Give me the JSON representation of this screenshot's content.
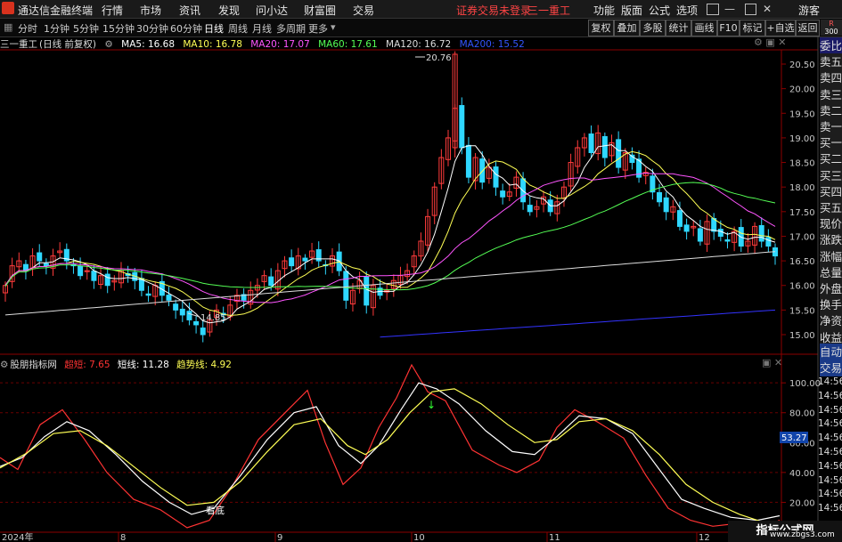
{
  "app_title": "通达信金融终端",
  "menu": [
    "行情",
    "市场",
    "资讯",
    "发现",
    "问小达",
    "财富圈",
    "交易"
  ],
  "status_notice": "证券交易未登录",
  "stock_name_top": "三一重工",
  "right_menu": [
    "功能",
    "版面",
    "公式",
    "选项"
  ],
  "guest": "游客",
  "periods": [
    "分时",
    "1分钟",
    "5分钟",
    "15分钟",
    "30分钟",
    "60分钟",
    "日线",
    "周线",
    "月线",
    "多周期",
    "更多"
  ],
  "active_period": "日线",
  "toolbar_buttons": [
    "复权",
    "叠加",
    "多股",
    "统计",
    "画线",
    "F10",
    "标记",
    "+自选",
    "返回"
  ],
  "colors": {
    "bg": "#000000",
    "up": "#ff3b3b",
    "down": "#2fd7ff",
    "ma5": "#ffffff",
    "ma10": "#ffff55",
    "ma20": "#ff55ff",
    "ma60": "#55ff55",
    "ma120": "#dddddd",
    "ma200": "#3333ff",
    "grid": "#8b0000",
    "price_label": "#ff5555"
  },
  "main_legend": {
    "stock": "三一重工",
    "mode": "(日线 前复权)",
    "ma": [
      {
        "label": "MA5: 16.68",
        "color": "#ffffff"
      },
      {
        "label": "MA10: 16.78",
        "color": "#ffff55"
      },
      {
        "label": "MA20: 17.07",
        "color": "#ff55ff"
      },
      {
        "label": "MA60: 17.61",
        "color": "#55ff55"
      },
      {
        "label": "MA120: 16.72",
        "color": "#dddddd"
      },
      {
        "label": "MA200: 15.52",
        "color": "#3355ff"
      }
    ]
  },
  "price_axis": [
    "20.50",
    "20.00",
    "19.50",
    "19.00",
    "18.50",
    "18.00",
    "17.50",
    "17.00",
    "16.50",
    "16.00",
    "15.50",
    "15.00"
  ],
  "high_marker": "20.76",
  "low_marker": "14.85",
  "right_panel_labels": [
    "委比",
    "卖五",
    "卖四",
    "卖三",
    "卖二",
    "卖一",
    "买一",
    "买二",
    "买三",
    "买四",
    "买五",
    "现价",
    "涨跌",
    "涨幅",
    "总量",
    "外盘",
    "换手",
    "净资",
    "收益"
  ],
  "right_panel_lower": [
    "自动",
    "交易"
  ],
  "right_panel_times": [
    "14:56",
    "14:56",
    "14:56",
    "14:56",
    "14:56",
    "14:56",
    "14:56",
    "14:56",
    "14:56",
    "14:56"
  ],
  "indicator_legend": {
    "name": "股朋指标网",
    "items": [
      {
        "label": "超短: 7.65",
        "color": "#ff3333"
      },
      {
        "label": "短线: 11.28",
        "color": "#ffffff"
      },
      {
        "label": "趋势线: 4.92",
        "color": "#ffff55"
      }
    ]
  },
  "indicator_axis": [
    "100.00",
    "80.00",
    "60.00",
    "40.00",
    "20.00"
  ],
  "indicator_current": "53.27",
  "bottom_label": "看底",
  "date_axis": [
    "2024年",
    "8",
    "9",
    "10",
    "11",
    "12"
  ],
  "watermark": {
    "line1": "指标公式网",
    "line2": "www.zbgs3.com"
  },
  "chart_data": [
    {
      "type": "candlestick",
      "ylim": [
        14.7,
        20.8
      ],
      "ma_values": {
        "MA5": 16.68,
        "MA10": 16.78,
        "MA20": 17.07,
        "MA60": 17.61,
        "MA120": 16.72,
        "MA200": 15.52
      },
      "high": 20.76,
      "low": 14.85
    },
    {
      "type": "line",
      "ylim": [
        0,
        115
      ],
      "series": [
        {
          "name": "超短",
          "last": 7.65
        },
        {
          "name": "短线",
          "last": 11.28
        },
        {
          "name": "趋势线",
          "last": 4.92
        }
      ]
    }
  ]
}
